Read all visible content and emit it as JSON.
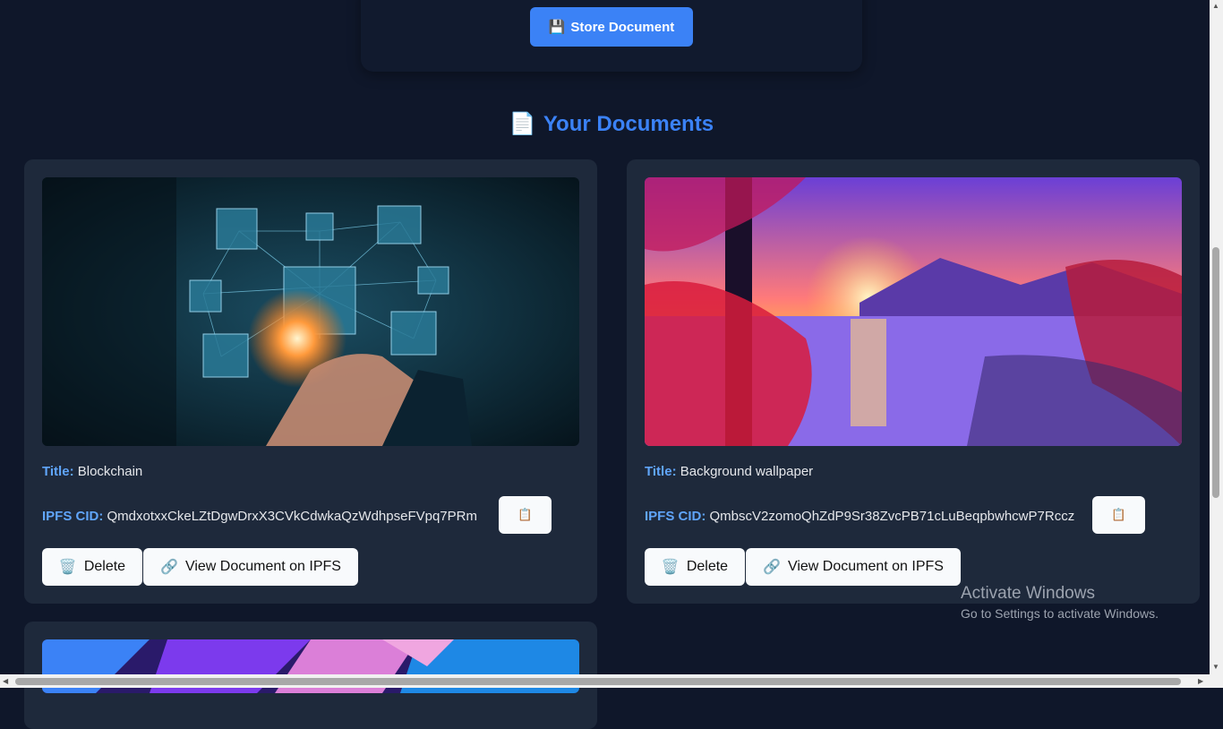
{
  "upload": {
    "store_label": "Store Document",
    "store_icon": "💾"
  },
  "documents_section": {
    "icon": "📄",
    "title": "Your Documents"
  },
  "documents": [
    {
      "image": "blockchain-network-cubes",
      "title_label": "Title:",
      "title": "Blockchain",
      "cid_label": "IPFS CID:",
      "cid": "QmdxotxxCkeLZtDgwDrxX3CVkCdwkaQzWdhpseFVpq7PRm",
      "copy_icon": "📋",
      "delete_icon": "🗑️",
      "delete_label": "Delete",
      "view_icon": "🔗",
      "view_label": "View Document on IPFS"
    },
    {
      "image": "sunset-lake-landscape",
      "title_label": "Title:",
      "title": "Background wallpaper",
      "cid_label": "IPFS CID:",
      "cid": "QmbscV2zomoQhZdP9Sr38ZvcPB71cLuBeqpbwhcwP7Rccz",
      "copy_icon": "📋",
      "delete_icon": "🗑️",
      "delete_label": "Delete",
      "view_icon": "🔗",
      "view_label": "View Document on IPFS"
    },
    {
      "image": "abstract-purple-cubes"
    }
  ],
  "watermark": {
    "line1": "Activate Windows",
    "line2": "Go to Settings to activate Windows."
  },
  "scroll_arrows": {
    "up": "▲",
    "down": "▼",
    "left": "◀",
    "right": "▶"
  },
  "colors": {
    "background": "#0f172a",
    "card": "#1e293b",
    "accent": "#3b82f6",
    "label": "#60a5fa"
  }
}
